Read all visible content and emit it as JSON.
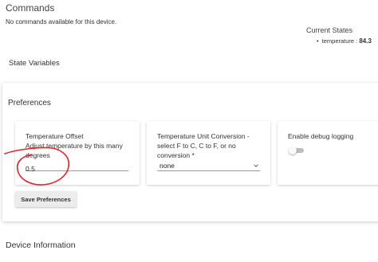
{
  "commands": {
    "title": "Commands",
    "note": "No commands available for this device."
  },
  "current_states": {
    "title": "Current States",
    "items": [
      {
        "name": "temperature",
        "separator": " : ",
        "value": "84.3"
      }
    ]
  },
  "state_variables": {
    "title": "State Variables"
  },
  "preferences": {
    "title": "Preferences",
    "temperature_offset": {
      "label": "Temperature Offset",
      "desc_line1": "Adjust temperature by this many",
      "desc_line2": "degrees",
      "value": "0.5"
    },
    "unit_conversion": {
      "label_line1": "Temperature Unit Conversion -",
      "label_line2": "select F to C, C to F, or no",
      "label_line3": "conversion *",
      "selected": "none"
    },
    "debug_logging": {
      "label": "Enable debug logging",
      "enabled": false
    },
    "save_label": "Save Preferences"
  },
  "device_information": {
    "title": "Device Information"
  },
  "colors": {
    "annotation_stroke": "#e0252b",
    "toggle_track": "#bdbdbd",
    "button_bg": "#ececec"
  },
  "icons": {
    "select_arrow": "chevron-down-icon",
    "annotation": "circle-annotation"
  }
}
